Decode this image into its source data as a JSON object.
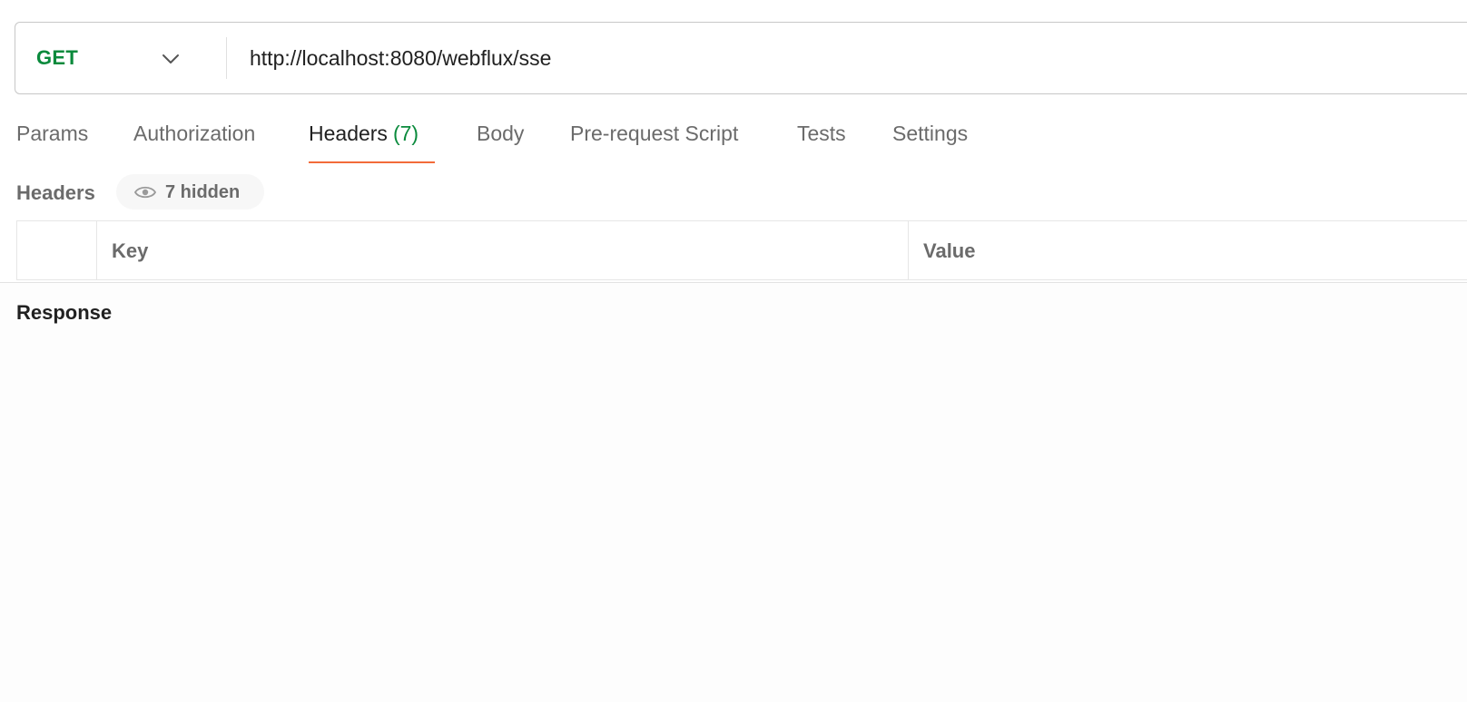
{
  "request": {
    "method": "GET",
    "url": "http://localhost:8080/webflux/sse"
  },
  "tabs": [
    {
      "label": "Params"
    },
    {
      "label": "Authorization"
    },
    {
      "label": "Headers",
      "count": "(7)",
      "active": true
    },
    {
      "label": "Body"
    },
    {
      "label": "Pre-request Script"
    },
    {
      "label": "Tests"
    },
    {
      "label": "Settings"
    }
  ],
  "headers_section": {
    "title": "Headers",
    "hidden_toggle": "7 hidden",
    "table": {
      "columns": [
        "Key",
        "Value"
      ]
    }
  },
  "response": {
    "title": "Response"
  },
  "colors": {
    "method_green": "#0a8a3c",
    "active_tab_underline": "#f26b3a"
  },
  "icons": {
    "method_dropdown": "chevron-down-icon",
    "hidden_toggle": "eye-icon"
  }
}
